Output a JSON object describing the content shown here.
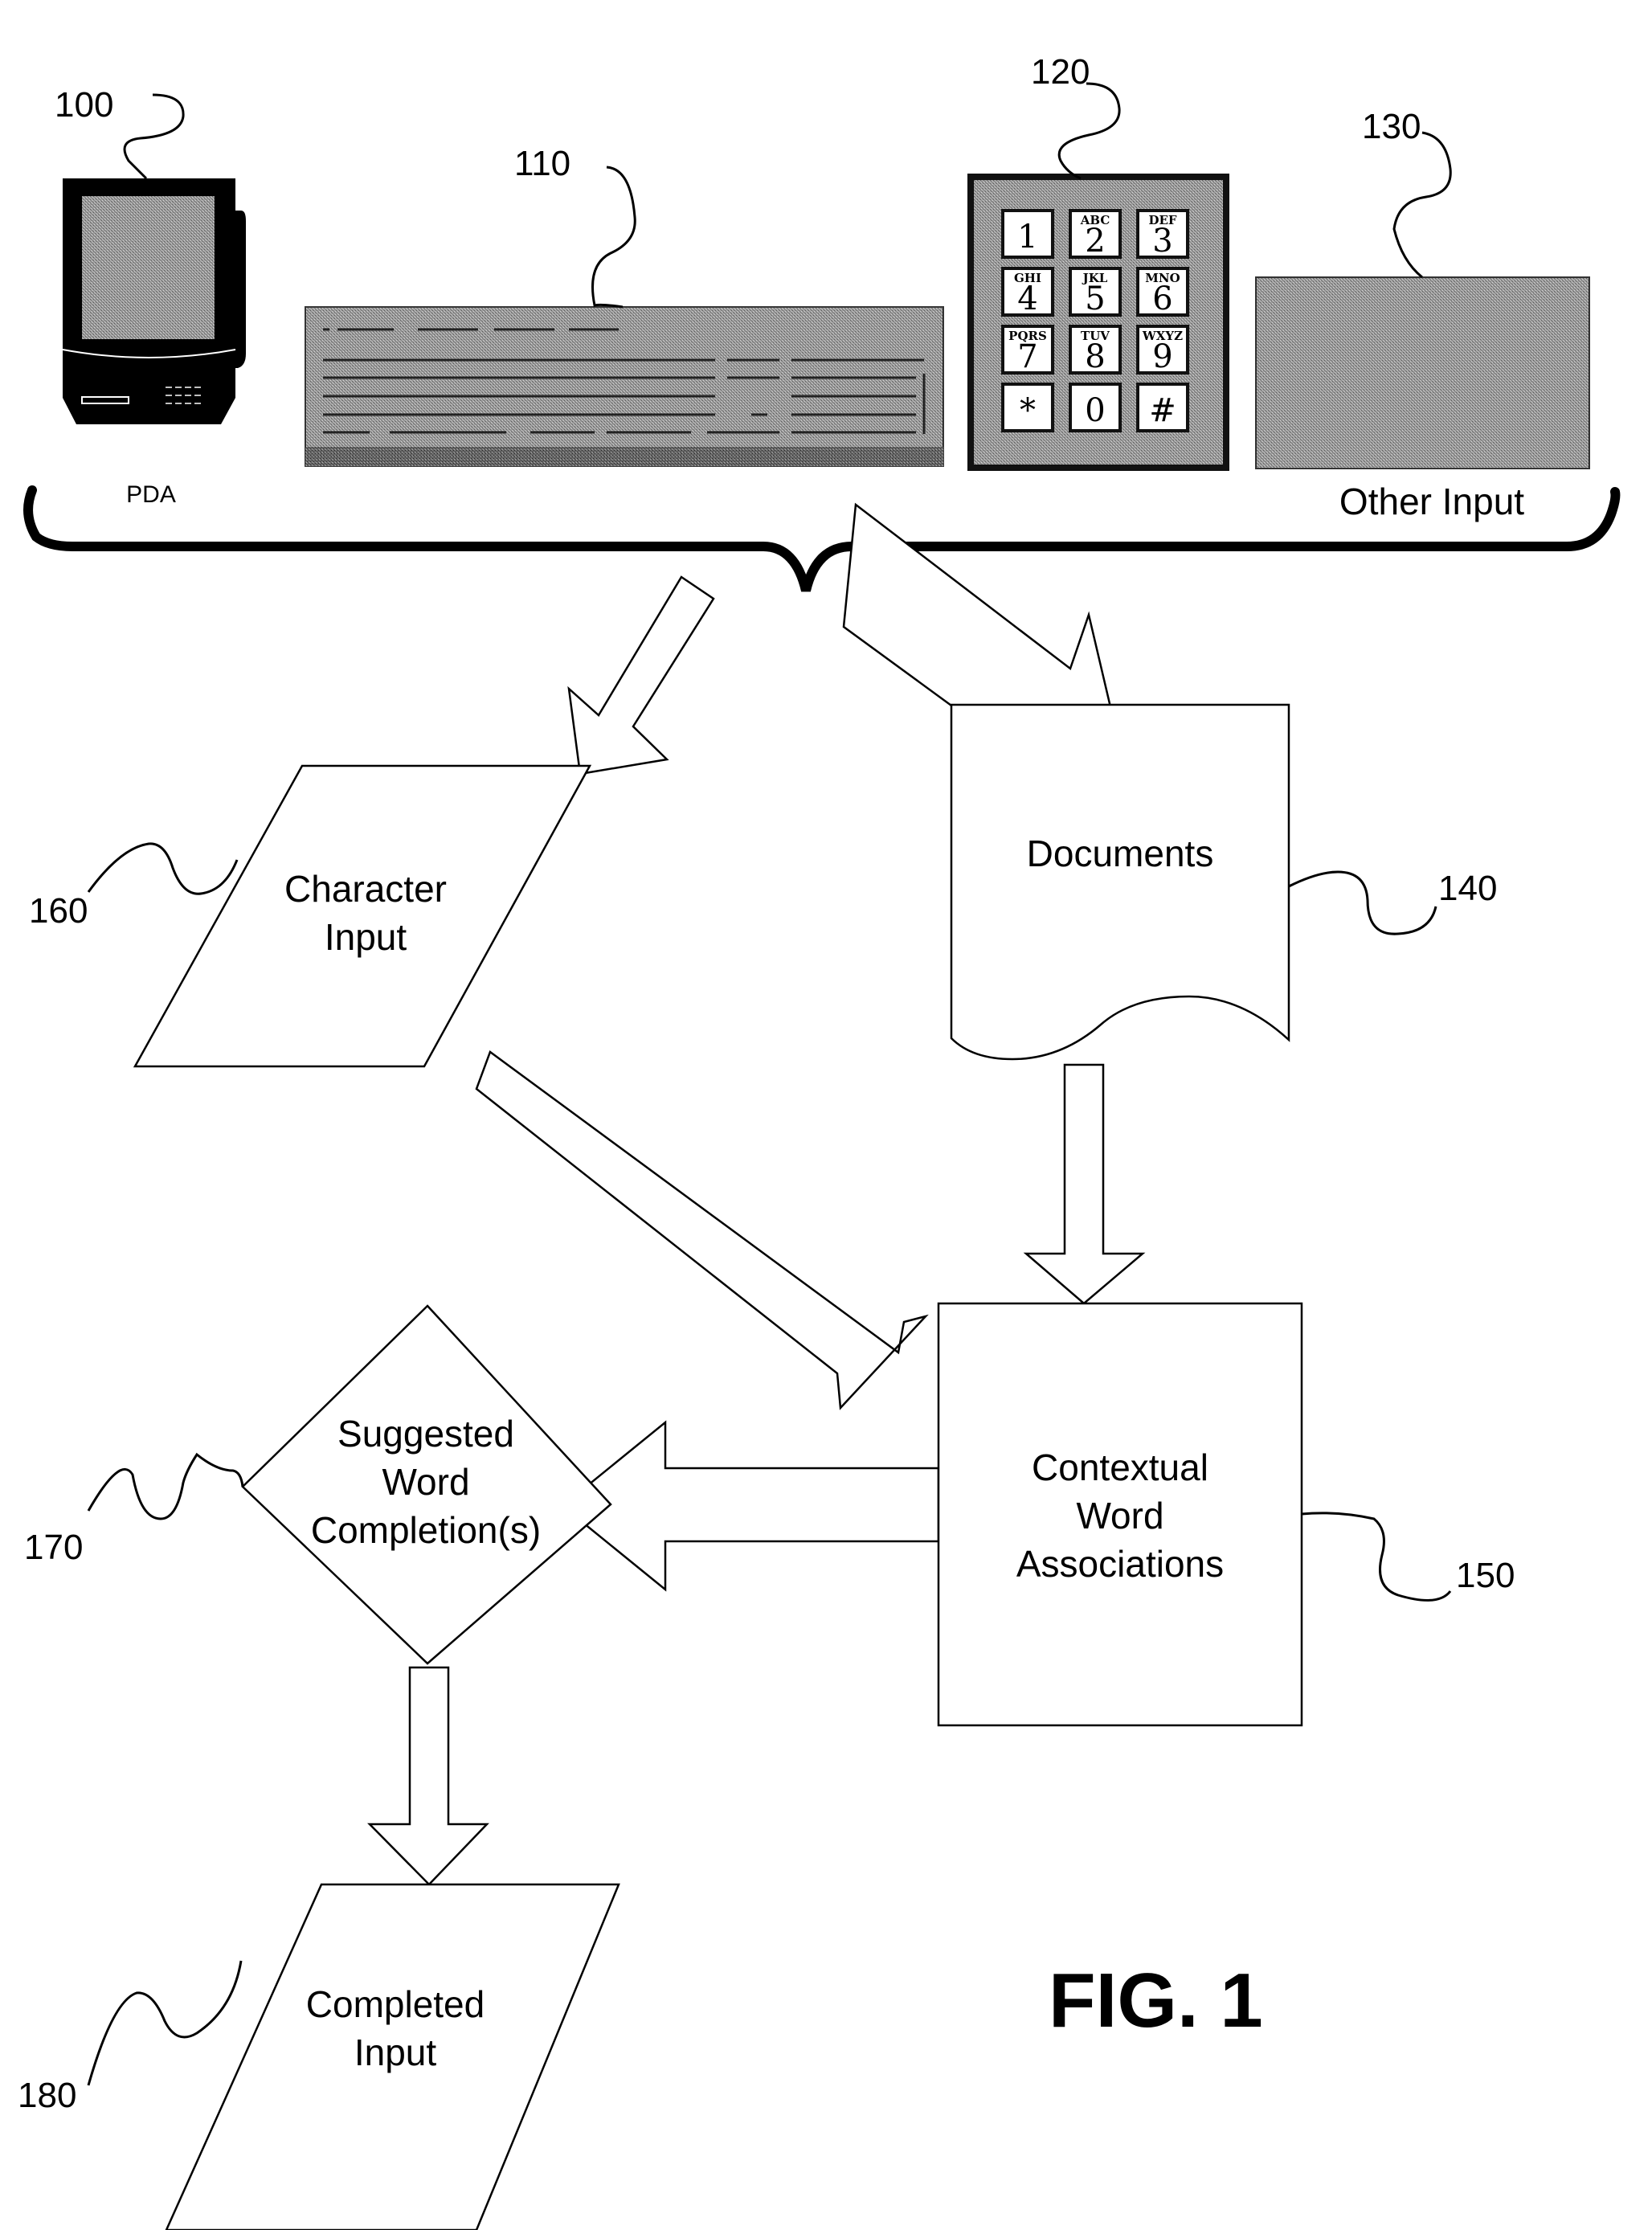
{
  "figure": {
    "title": "FIG. 1",
    "devices": {
      "pda": {
        "ref": "100",
        "label": "PDA"
      },
      "keyboard": {
        "ref": "110"
      },
      "keypad": {
        "ref": "120",
        "keys": [
          {
            "num": "1",
            "letters": ""
          },
          {
            "num": "2",
            "letters": "ABC"
          },
          {
            "num": "3",
            "letters": "DEF"
          },
          {
            "num": "4",
            "letters": "GHI"
          },
          {
            "num": "5",
            "letters": "JKL"
          },
          {
            "num": "6",
            "letters": "MNO"
          },
          {
            "num": "7",
            "letters": "PQRS"
          },
          {
            "num": "8",
            "letters": "TUV"
          },
          {
            "num": "9",
            "letters": "WXYZ"
          },
          {
            "num": "*",
            "letters": ""
          },
          {
            "num": "0",
            "letters": ""
          },
          {
            "num": "#",
            "letters": ""
          }
        ]
      },
      "other": {
        "ref": "130",
        "label": "Other Input"
      }
    },
    "nodes": {
      "documents": {
        "ref": "140",
        "label": "Documents"
      },
      "contextual": {
        "ref": "150",
        "line1": "Contextual",
        "line2": "Word",
        "line3": "Associations"
      },
      "character_input": {
        "ref": "160",
        "line1": "Character",
        "line2": "Input"
      },
      "suggested": {
        "ref": "170",
        "line1": "Suggested",
        "line2": "Word",
        "line3": "Completion(s)"
      },
      "completed": {
        "ref": "180",
        "line1": "Completed",
        "line2": "Input"
      }
    },
    "colors": {
      "ink": "#000000",
      "paper": "#ffffff",
      "fill_gray": "#8a8a8a",
      "dark_gray": "#5a5a5a"
    }
  }
}
